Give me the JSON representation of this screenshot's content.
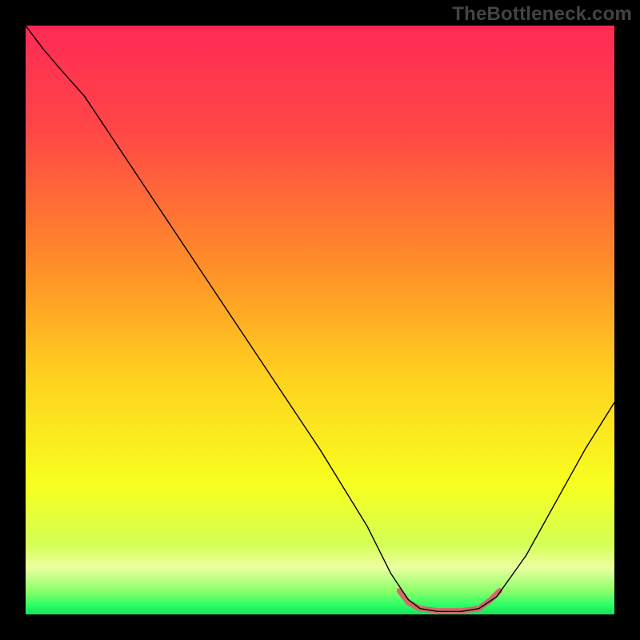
{
  "watermark": "TheBottleneck.com",
  "chart_data": {
    "type": "line",
    "title": "",
    "xlabel": "",
    "ylabel": "",
    "xlim": [
      0,
      100
    ],
    "ylim": [
      0,
      100
    ],
    "background_gradient": {
      "stops": [
        {
          "offset": 0.0,
          "color": "#ff2a55"
        },
        {
          "offset": 0.18,
          "color": "#ff4747"
        },
        {
          "offset": 0.4,
          "color": "#ff8c29"
        },
        {
          "offset": 0.6,
          "color": "#ffd21f"
        },
        {
          "offset": 0.78,
          "color": "#f7ff1f"
        },
        {
          "offset": 0.88,
          "color": "#d4ff55"
        },
        {
          "offset": 0.92,
          "color": "#ecffa0"
        },
        {
          "offset": 0.96,
          "color": "#8cff6a"
        },
        {
          "offset": 0.985,
          "color": "#2aff66"
        },
        {
          "offset": 1.0,
          "color": "#19e05a"
        }
      ]
    },
    "series": [
      {
        "name": "curve",
        "stroke": "#000000",
        "stroke_width": 1.4,
        "points": [
          {
            "x": 0.0,
            "y": 100.0
          },
          {
            "x": 3.0,
            "y": 96.0
          },
          {
            "x": 6.0,
            "y": 92.5
          },
          {
            "x": 10.0,
            "y": 88.0
          },
          {
            "x": 20.0,
            "y": 73.0
          },
          {
            "x": 30.0,
            "y": 58.0
          },
          {
            "x": 40.0,
            "y": 43.0
          },
          {
            "x": 50.0,
            "y": 28.0
          },
          {
            "x": 58.0,
            "y": 15.0
          },
          {
            "x": 62.0,
            "y": 7.0
          },
          {
            "x": 65.0,
            "y": 2.5
          },
          {
            "x": 67.0,
            "y": 1.0
          },
          {
            "x": 70.0,
            "y": 0.5
          },
          {
            "x": 74.0,
            "y": 0.5
          },
          {
            "x": 77.0,
            "y": 1.0
          },
          {
            "x": 80.0,
            "y": 3.0
          },
          {
            "x": 85.0,
            "y": 10.0
          },
          {
            "x": 90.0,
            "y": 19.0
          },
          {
            "x": 95.0,
            "y": 28.0
          },
          {
            "x": 100.0,
            "y": 36.0
          }
        ]
      }
    ],
    "highlight": {
      "name": "bottom-band",
      "stroke": "#d26a6a",
      "stroke_width": 7,
      "points": [
        {
          "x": 63.5,
          "y": 4.0
        },
        {
          "x": 65.0,
          "y": 2.0
        },
        {
          "x": 67.0,
          "y": 1.0
        },
        {
          "x": 70.0,
          "y": 0.6
        },
        {
          "x": 74.0,
          "y": 0.6
        },
        {
          "x": 77.0,
          "y": 1.0
        },
        {
          "x": 79.0,
          "y": 2.5
        },
        {
          "x": 80.5,
          "y": 4.0
        }
      ]
    }
  }
}
